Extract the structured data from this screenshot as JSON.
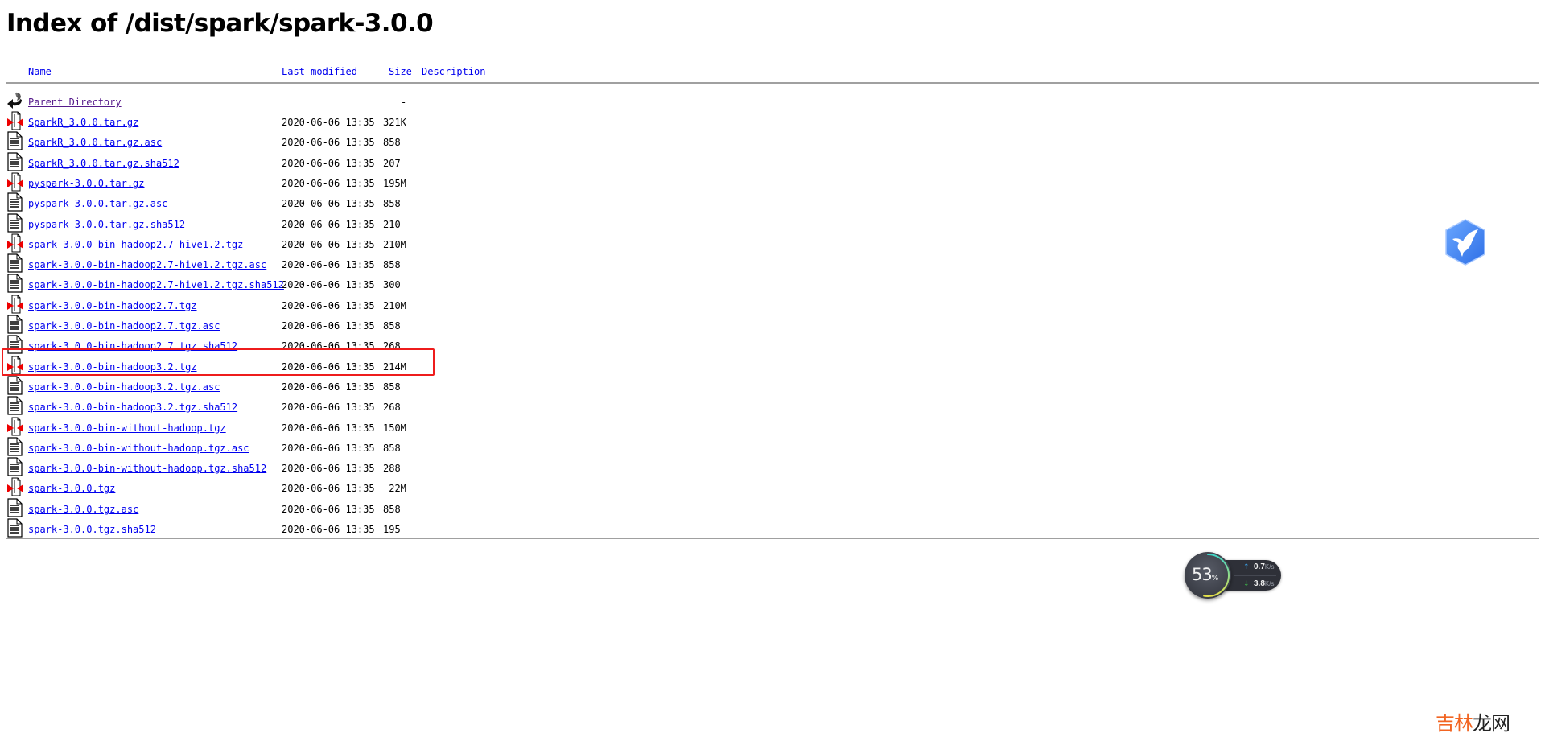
{
  "page": {
    "title": "Index of /dist/spark/spark-3.0.0"
  },
  "table": {
    "headers": {
      "name": "Name",
      "last_modified": "Last modified",
      "size": "Size",
      "description": "Description"
    },
    "parent": {
      "name": "Parent Directory",
      "size": "-",
      "icon": "back-arrow-icon"
    },
    "rows": [
      {
        "name": "SparkR_3.0.0.tar.gz",
        "date": "2020-06-06 13:35",
        "size": "321K",
        "icon": "archive-icon"
      },
      {
        "name": "SparkR_3.0.0.tar.gz.asc",
        "date": "2020-06-06 13:35",
        "size": "858",
        "icon": "text-file-icon"
      },
      {
        "name": "SparkR_3.0.0.tar.gz.sha512",
        "date": "2020-06-06 13:35",
        "size": "207",
        "icon": "text-file-icon"
      },
      {
        "name": "pyspark-3.0.0.tar.gz",
        "date": "2020-06-06 13:35",
        "size": "195M",
        "icon": "archive-icon"
      },
      {
        "name": "pyspark-3.0.0.tar.gz.asc",
        "date": "2020-06-06 13:35",
        "size": "858",
        "icon": "text-file-icon"
      },
      {
        "name": "pyspark-3.0.0.tar.gz.sha512",
        "date": "2020-06-06 13:35",
        "size": "210",
        "icon": "text-file-icon"
      },
      {
        "name": "spark-3.0.0-bin-hadoop2.7-hive1.2.tgz",
        "date": "2020-06-06 13:35",
        "size": "210M",
        "icon": "archive-icon"
      },
      {
        "name": "spark-3.0.0-bin-hadoop2.7-hive1.2.tgz.asc",
        "date": "2020-06-06 13:35",
        "size": "858",
        "icon": "text-file-icon"
      },
      {
        "name": "spark-3.0.0-bin-hadoop2.7-hive1.2.tgz.sha512",
        "date": "2020-06-06 13:35",
        "size": "300",
        "icon": "text-file-icon"
      },
      {
        "name": "spark-3.0.0-bin-hadoop2.7.tgz",
        "date": "2020-06-06 13:35",
        "size": "210M",
        "icon": "archive-icon"
      },
      {
        "name": "spark-3.0.0-bin-hadoop2.7.tgz.asc",
        "date": "2020-06-06 13:35",
        "size": "858",
        "icon": "text-file-icon"
      },
      {
        "name": "spark-3.0.0-bin-hadoop2.7.tgz.sha512",
        "date": "2020-06-06 13:35",
        "size": "268",
        "icon": "text-file-icon"
      },
      {
        "name": "spark-3.0.0-bin-hadoop3.2.tgz",
        "date": "2020-06-06 13:35",
        "size": "214M",
        "icon": "archive-icon",
        "highlighted": true
      },
      {
        "name": "spark-3.0.0-bin-hadoop3.2.tgz.asc",
        "date": "2020-06-06 13:35",
        "size": "858",
        "icon": "text-file-icon"
      },
      {
        "name": "spark-3.0.0-bin-hadoop3.2.tgz.sha512",
        "date": "2020-06-06 13:35",
        "size": "268",
        "icon": "text-file-icon"
      },
      {
        "name": "spark-3.0.0-bin-without-hadoop.tgz",
        "date": "2020-06-06 13:35",
        "size": "150M",
        "icon": "archive-icon"
      },
      {
        "name": "spark-3.0.0-bin-without-hadoop.tgz.asc",
        "date": "2020-06-06 13:35",
        "size": "858",
        "icon": "text-file-icon"
      },
      {
        "name": "spark-3.0.0-bin-without-hadoop.tgz.sha512",
        "date": "2020-06-06 13:35",
        "size": "288",
        "icon": "text-file-icon"
      },
      {
        "name": "spark-3.0.0.tgz",
        "date": "2020-06-06 13:35",
        "size": " 22M",
        "icon": "archive-icon"
      },
      {
        "name": "spark-3.0.0.tgz.asc",
        "date": "2020-06-06 13:35",
        "size": "858",
        "icon": "text-file-icon"
      },
      {
        "name": "spark-3.0.0.tgz.sha512",
        "date": "2020-06-06 13:35",
        "size": "195",
        "icon": "text-file-icon"
      }
    ]
  },
  "overlays": {
    "thunder_icon": "bird-icon",
    "network_widget": {
      "usage_percent": 53,
      "percent_value": "53",
      "percent_sign": "%",
      "upload_value": "0.7",
      "download_value": "3.8",
      "unit": "K/s"
    },
    "watermark": {
      "part1": "吉林",
      "part2": "龙网"
    }
  },
  "colors": {
    "link": "#0000ee",
    "visited_link": "#551a8b",
    "highlight_box": "#ee1c1c",
    "watermark_accent": "#f26522",
    "upload_arrow": "#3aa6f0",
    "download_arrow": "#3cb34a"
  }
}
